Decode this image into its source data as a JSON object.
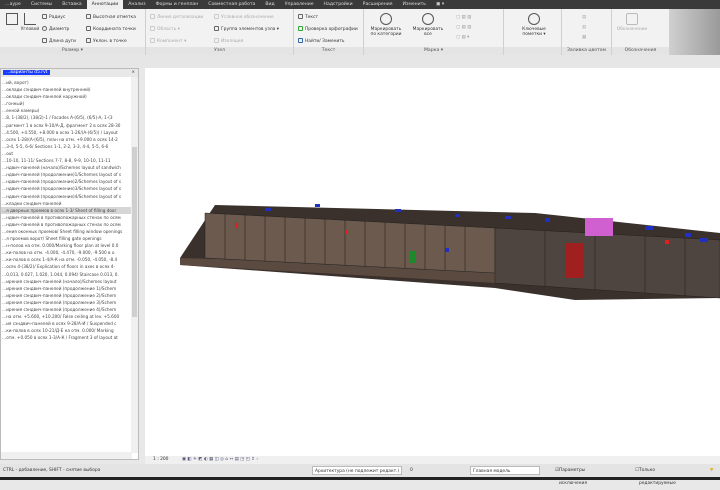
{
  "tabs": [
    "…ауре",
    "Системы",
    "Вставка",
    "Аннотации",
    "Анализ",
    "Формы и генплан",
    "Совместная работа",
    "Вид",
    "Управление",
    "Надстройки",
    "Расширения",
    "Изменить",
    "▣ ▾"
  ],
  "active_tab": 3,
  "ribbon": {
    "dimension": {
      "label": "Размер ▾",
      "linear": "Угловой",
      "items": [
        "Радиус",
        "Диаметр",
        "Длина дуги",
        "Высотная отметка",
        "Координата точки",
        "Уклон. в точке"
      ]
    },
    "detail": {
      "label": "Узел",
      "items": [
        "Линия детализации",
        "Область ▾",
        "Компонент ▾",
        "Условное обозначение",
        "Группа элементов узла ▾",
        "Изоляция"
      ]
    },
    "text": {
      "label": "Текст",
      "items": [
        "Текст",
        "Проверка орфографии",
        "Найти/ Заменить"
      ]
    },
    "tag": {
      "label": "Марка ▾",
      "items": [
        "Маркировать по категории",
        "Маркировать все"
      ]
    },
    "keynote": {
      "label": "",
      "items": [
        "Ключевые пометки ▾"
      ]
    },
    "color_fill": {
      "label": "Заливка цветом"
    },
    "symbol": {
      "label": "Обозначения",
      "items": [
        "Обозначение"
      ]
    }
  },
  "browser": {
    "title": "…варианты d5.rvt",
    "close": "×",
    "tree": [
      "",
      "",
      "…ий, ворот)",
      "…оклади сэндвич-панелей внутренней)",
      "…оклади сэндвич-панелей наружной)",
      "",
      "",
      "",
      "",
      "…гонный)",
      "…енной камеры)",
      "",
      "",
      "",
      "…8, 1-(38/2), (38/2)-1 / Facades A-(6/5), (6/5)-A, 1-(3",
      "…рагмент 1 в осях 9-10/А-Д, фрагмент 2 в осях 28-30",
      "…4.500, +4.550, +8.000 в осях 1-26/(А-(6/5)) / Layout",
      "…осях 1-28/(А-(6/5), план на отм. +9.000 в осях 14-2",
      "…3-4, 5-5, 6-6/ Sections 1-1, 2-2, 3-3, 4-4, 5-5, 6-6",
      "…out",
      "…10-10, 11-11/ Sections 7-7, 8-8, 9-9, 10-10, 11-11",
      "…ндвич-панелей (начало)/Schemes layout of sandwich",
      "…ндвич-панелей (продолжение)1/Schemes layout of s",
      "…ндвич-панелей (продолжение)2/Schemes layout of s",
      "…ндвич-панелей (продолжение)3/Schemes layout of s",
      "…ндвич-панелей (продолжение)4/Schemes layout of s",
      "…кладки сэндвич-панелей",
      "…я дверных проемов в осях 1-3/ Sheet of filling door",
      "…ндвич-панелей в противопожарных стенах по осям",
      "…ндвич-панелей в противопожарных стенах по осям",
      "…ения оконных проемов/ Sheet filling window openings",
      "…я проемов ворот/ Sheet filling gate openings",
      "…н-полов на отм. 0.000/Marking floor plan at level 0.0",
      "…ки-полов на отм. -4.000, -4.470, -9.000, -9.500 в о",
      "…ки-полов в осях 1-4/А-К на отм. -0.050, -4.050, -8.4",
      "…осях 4-(38/2)/ Explication of floors in axes в осях 4-",
      "…0.013, 0.027, 1.020, 1.044, 0.094/ Staircase 0.013, 0.",
      "…ирения сэндвич-панелей (начало)/Schemes layout",
      "…ирения сэндвич-панелей (продолжение 1)/Schem",
      "…ирения сэндвич-панелей (продолжение 2)/Schem",
      "…ирения сэндвич-панелей (продолжение 3)/Schem",
      "…ирения сэндвич-панелей (продолжение 4)/Schem",
      "…на отм. +5.600, +10.200/ False ceiling at lev. +5.600",
      "…ия сэндвич-панелей в осях 9-28/А-И / Suspended c",
      "…ки-полов в осях 10-21/Д-Е на отм. 0.000/ Marking",
      "…отм. +0.050 в осях 1-3/А-К / Fragment 3 of layout at"
    ],
    "highlighted": [
      27
    ]
  },
  "viewbar": {
    "scale": "1 : 200"
  },
  "status": {
    "hint": "CTRL - добавление, SHIFT - снятие выбора",
    "workset": "Архитектура (не подлежит редакт.)",
    "workset_count": "0",
    "design_option": "Главная модель",
    "exclude_options": "Параметры исключения",
    "editable_only": "Только редактируемые",
    "exclude_checked": true,
    "editable_checked": false
  }
}
